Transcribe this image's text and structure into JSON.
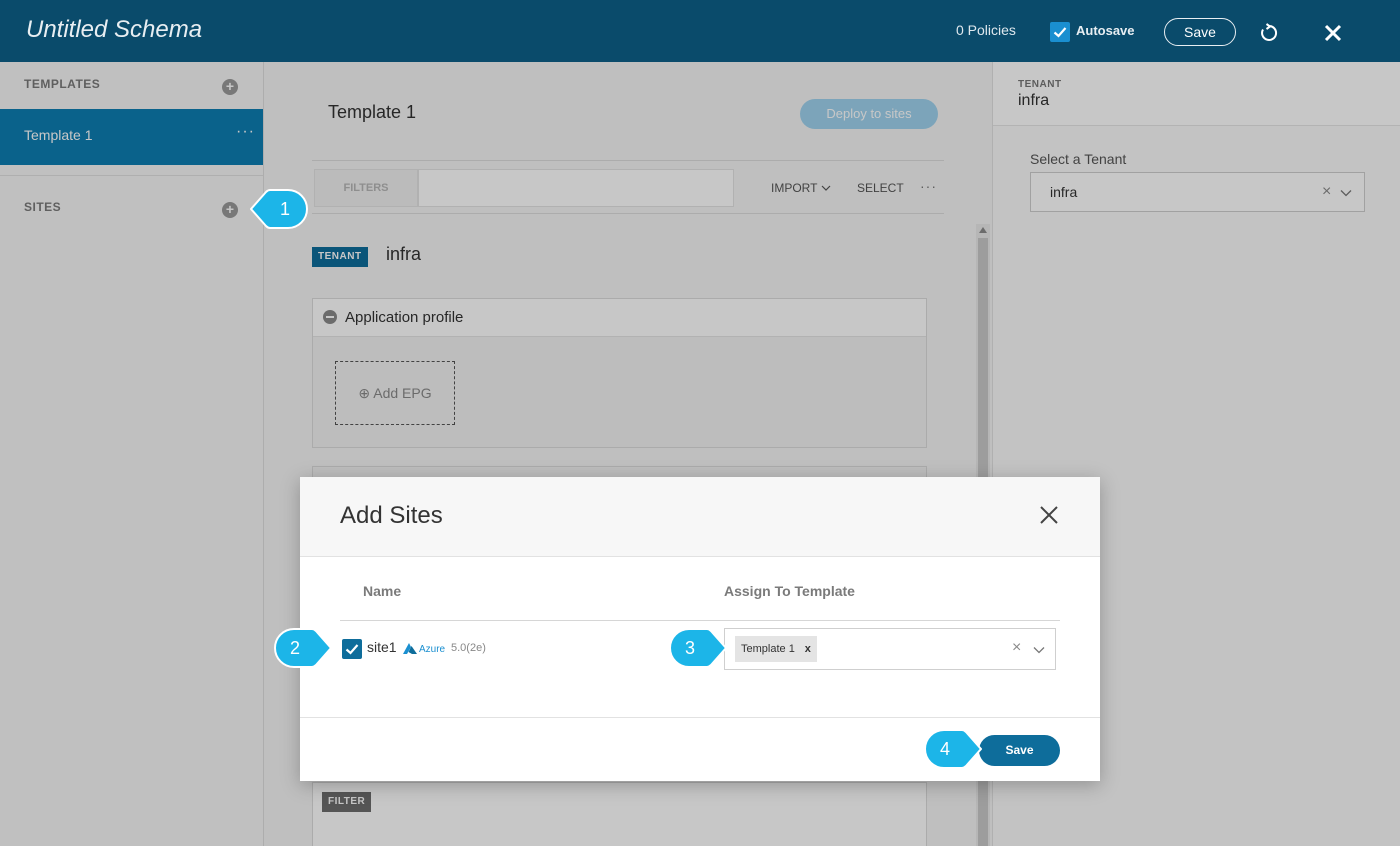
{
  "header": {
    "title": "Untitled Schema",
    "policies": "0 Policies",
    "autosave_label": "Autosave",
    "autosave_checked": true,
    "save_label": "Save"
  },
  "sidebar": {
    "templates_title": "TEMPLATES",
    "templates": [
      {
        "label": "Template 1",
        "more": "···"
      }
    ],
    "sites_title": "SITES"
  },
  "main": {
    "template_title": "Template 1",
    "deploy_label": "Deploy to sites",
    "filters_label": "FILTERS",
    "import_label": "IMPORT",
    "select_label": "SELECT",
    "more_label": "···",
    "tenant_badge": "TENANT",
    "tenant_name": "infra",
    "app_profile_label": "Application profile",
    "add_epg_label": "Add EPG",
    "filter_badge": "FILTER"
  },
  "right_panel": {
    "tenant_small": "TENANT",
    "tenant_big": "infra",
    "select_label": "Select a Tenant",
    "select_value": "infra"
  },
  "modal": {
    "title": "Add Sites",
    "col_name": "Name",
    "col_assign": "Assign To Template",
    "rows": [
      {
        "site": "site1",
        "cloud": "Azure",
        "version": "5.0(2e)",
        "checked": true,
        "assigned": "Template 1",
        "chip_remove": "x"
      }
    ],
    "save_label": "Save"
  },
  "callouts": [
    "1",
    "2",
    "3",
    "4"
  ],
  "colors": {
    "header_bg": "#0a4b6b",
    "accent": "#0e6d9b",
    "callout": "#1cb5e8"
  }
}
